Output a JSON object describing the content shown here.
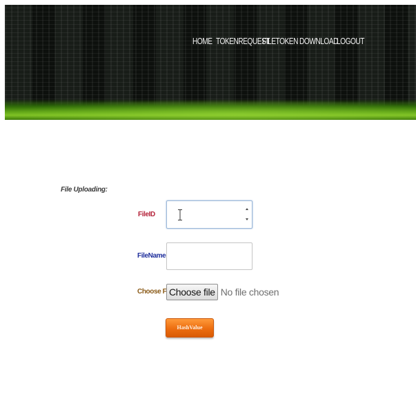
{
  "nav": {
    "items": [
      {
        "label": "HOME"
      },
      {
        "label": "TOKENREQUEST"
      },
      {
        "label": "FILETOKEN"
      },
      {
        "label": "DOWNLOAD"
      },
      {
        "label": "LOGOUT"
      }
    ]
  },
  "form": {
    "section_label": "File Uploading:",
    "fileid_label": "FileID",
    "fileid_value": "",
    "filename_label": "FileName",
    "filename_value": "",
    "choose_label": "Choose File",
    "choose_button": "Choose file",
    "file_status": "No file chosen",
    "submit_label": "HashValue"
  },
  "colors": {
    "header_bg": "#0d100d",
    "header_glow": "#5ea316",
    "fileid_label": "#b4233a",
    "filename_label": "#1f2f9c",
    "choose_label": "#8a5a17",
    "submit_bg": "#ec6d10"
  },
  "icons": {
    "text_cursor": "text-cursor-icon",
    "spinner": "spinner-arrows-icon"
  }
}
